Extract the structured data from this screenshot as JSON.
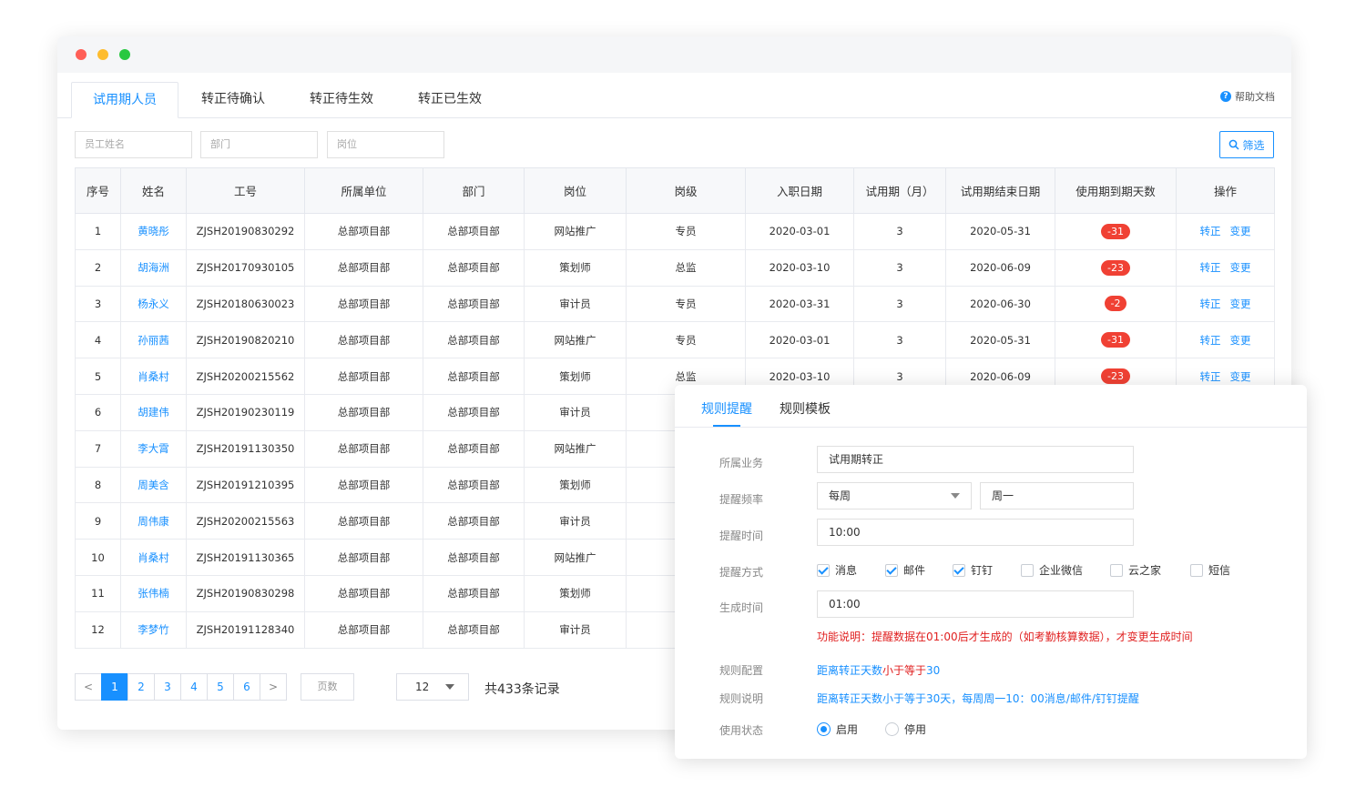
{
  "tabs": [
    "试用期人员",
    "转正待确认",
    "转正待生效",
    "转正已生效"
  ],
  "help": {
    "label": "帮助文档",
    "icon": "help-circle-icon"
  },
  "filters": {
    "name_placeholder": "员工姓名",
    "dept_placeholder": "部门",
    "position_placeholder": "岗位",
    "filter_label": "筛选"
  },
  "table": {
    "headers": [
      "序号",
      "姓名",
      "工号",
      "所属单位",
      "部门",
      "岗位",
      "岗级",
      "入职日期",
      "试用期（月）",
      "试用期结束日期",
      "使用期到期天数",
      "操作"
    ],
    "actions": {
      "confirm": "转正",
      "change": "变更"
    },
    "rows": [
      {
        "no": "1",
        "name": "黄晓彤",
        "id": "ZJSH20190830292",
        "unit": "总部项目部",
        "dept": "总部项目部",
        "position": "网站推广",
        "grade": "专员",
        "hire": "2020-03-01",
        "probation": "3",
        "end": "2020-05-31",
        "days": "-31"
      },
      {
        "no": "2",
        "name": "胡海洲",
        "id": "ZJSH20170930105",
        "unit": "总部项目部",
        "dept": "总部项目部",
        "position": "策划师",
        "grade": "总监",
        "hire": "2020-03-10",
        "probation": "3",
        "end": "2020-06-09",
        "days": "-23"
      },
      {
        "no": "3",
        "name": "杨永义",
        "id": "ZJSH20180630023",
        "unit": "总部项目部",
        "dept": "总部项目部",
        "position": "审计员",
        "grade": "专员",
        "hire": "2020-03-31",
        "probation": "3",
        "end": "2020-06-30",
        "days": "-2"
      },
      {
        "no": "4",
        "name": "孙丽茜",
        "id": "ZJSH20190820210",
        "unit": "总部项目部",
        "dept": "总部项目部",
        "position": "网站推广",
        "grade": "专员",
        "hire": "2020-03-01",
        "probation": "3",
        "end": "2020-05-31",
        "days": "-31"
      },
      {
        "no": "5",
        "name": "肖桑村",
        "id": "ZJSH20200215562",
        "unit": "总部项目部",
        "dept": "总部项目部",
        "position": "策划师",
        "grade": "总监",
        "hire": "2020-03-10",
        "probation": "3",
        "end": "2020-06-09",
        "days": "-23"
      },
      {
        "no": "6",
        "name": "胡建伟",
        "id": "ZJSH20190230119",
        "unit": "总部项目部",
        "dept": "总部项目部",
        "position": "审计员"
      },
      {
        "no": "7",
        "name": "李大霄",
        "id": "ZJSH20191130350",
        "unit": "总部项目部",
        "dept": "总部项目部",
        "position": "网站推广"
      },
      {
        "no": "8",
        "name": "周美含",
        "id": "ZJSH20191210395",
        "unit": "总部项目部",
        "dept": "总部项目部",
        "position": "策划师"
      },
      {
        "no": "9",
        "name": "周伟康",
        "id": "ZJSH20200215563",
        "unit": "总部项目部",
        "dept": "总部项目部",
        "position": "审计员"
      },
      {
        "no": "10",
        "name": "肖桑村",
        "id": "ZJSH20191130365",
        "unit": "总部项目部",
        "dept": "总部项目部",
        "position": "网站推广"
      },
      {
        "no": "11",
        "name": "张伟楠",
        "id": "ZJSH20190830298",
        "unit": "总部项目部",
        "dept": "总部项目部",
        "position": "策划师"
      },
      {
        "no": "12",
        "name": "李梦竹",
        "id": "ZJSH20191128340",
        "unit": "总部项目部",
        "dept": "总部项目部",
        "position": "审计员"
      }
    ]
  },
  "pagination": {
    "prev": "<",
    "next": ">",
    "pages": [
      "1",
      "2",
      "3",
      "4",
      "5",
      "6"
    ],
    "active": "1",
    "page_input_placeholder": "页数",
    "page_size": "12",
    "total": "共433条记录"
  },
  "panel": {
    "tabs": [
      "规则提醒",
      "规则模板"
    ],
    "business_label": "所属业务",
    "business_value": "试用期转正",
    "freq_label": "提醒频率",
    "freq_value": "每周",
    "freq_day": "周一",
    "time_label": "提醒时间",
    "time_value": "10:00",
    "method_label": "提醒方式",
    "methods": [
      {
        "label": "消息",
        "checked": true
      },
      {
        "label": "邮件",
        "checked": true
      },
      {
        "label": "钉钉",
        "checked": true
      },
      {
        "label": "企业微信",
        "checked": false
      },
      {
        "label": "云之家",
        "checked": false
      },
      {
        "label": "短信",
        "checked": false
      }
    ],
    "gen_label": "生成时间",
    "gen_value": "01:00",
    "note": "功能说明：提醒数据在01:00后才生成的（如考勤核算数据），才变更生成时间",
    "config_label": "规则配置",
    "config_blue": "距离转正天数",
    "config_red": "小于等于",
    "config_num": "30",
    "desc_label": "规则说明",
    "desc_value": "距离转正天数小于等于30天，每周周一10：00消息/邮件/钉钉提醒",
    "status_label": "使用状态",
    "status_on": "启用",
    "status_off": "停用"
  }
}
